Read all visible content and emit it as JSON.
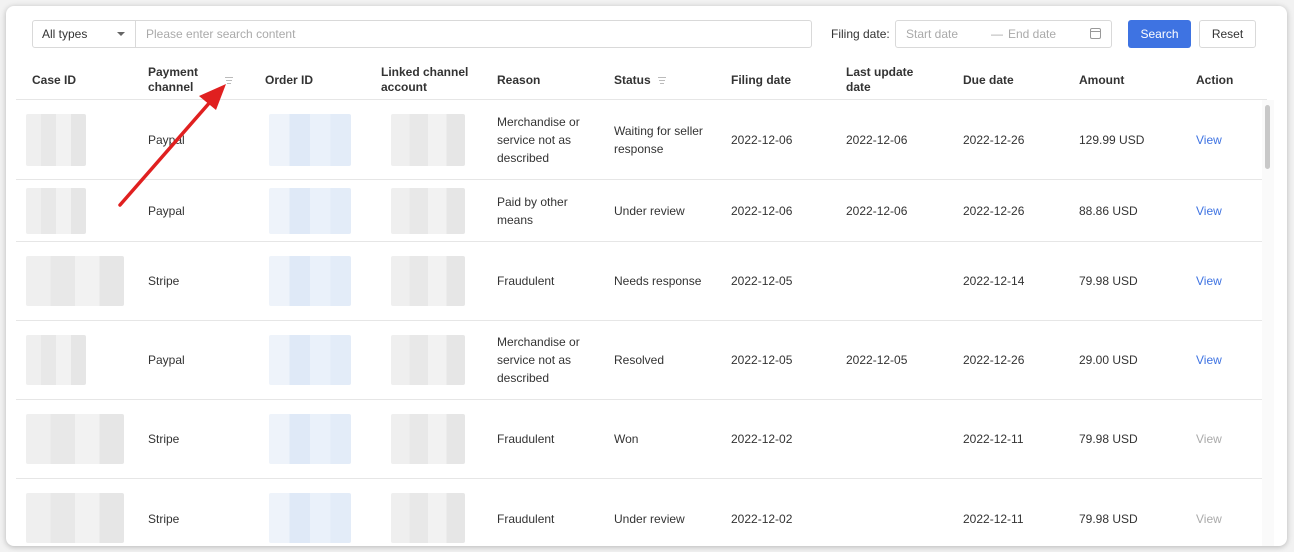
{
  "toolbar": {
    "type_select_value": "All types",
    "search_placeholder": "Please enter search content",
    "filing_date_label": "Filing date:",
    "start_date_placeholder": "Start date",
    "date_separator": "—",
    "end_date_placeholder": "End date",
    "search_button": "Search",
    "reset_button": "Reset"
  },
  "columns": {
    "case_id": "Case ID",
    "payment_channel": "Payment channel",
    "order_id": "Order ID",
    "linked_account": "Linked channel account",
    "reason": "Reason",
    "status": "Status",
    "filing_date": "Filing date",
    "last_update": "Last update date",
    "due_date": "Due date",
    "amount": "Amount",
    "action": "Action"
  },
  "rows": [
    {
      "channel": "Paypal",
      "reason": "Merchandise or service not as described",
      "status": "Waiting for seller response",
      "filing": "2022-12-06",
      "updated": "2022-12-06",
      "due": "2022-12-26",
      "amount": "129.99 USD",
      "action": "View"
    },
    {
      "channel": "Paypal",
      "reason": "Paid by other means",
      "status": "Under review",
      "filing": "2022-12-06",
      "updated": "2022-12-06",
      "due": "2022-12-26",
      "amount": "88.86 USD",
      "action": "View"
    },
    {
      "channel": "Stripe",
      "reason": "Fraudulent",
      "status": "Needs response",
      "filing": "2022-12-05",
      "updated": "",
      "due": "2022-12-14",
      "amount": "79.98 USD",
      "action": "View"
    },
    {
      "channel": "Paypal",
      "reason": "Merchandise or service not as described",
      "status": "Resolved",
      "filing": "2022-12-05",
      "updated": "2022-12-05",
      "due": "2022-12-26",
      "amount": "29.00 USD",
      "action": "View"
    },
    {
      "channel": "Stripe",
      "reason": "Fraudulent",
      "status": "Won",
      "filing": "2022-12-02",
      "updated": "",
      "due": "2022-12-11",
      "amount": "79.98 USD",
      "action": "View"
    },
    {
      "channel": "Stripe",
      "reason": "Fraudulent",
      "status": "Under review",
      "filing": "2022-12-02",
      "updated": "",
      "due": "2022-12-11",
      "amount": "79.98 USD",
      "action": "View"
    }
  ],
  "colors": {
    "accent": "#3e73e2",
    "annotation_arrow": "#e02020"
  }
}
